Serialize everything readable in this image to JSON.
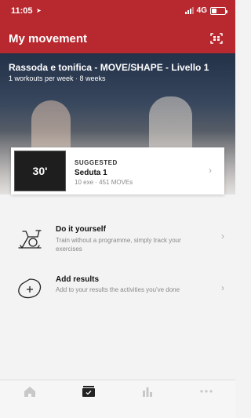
{
  "status_bar": {
    "time": "11:05",
    "network": "4G"
  },
  "header": {
    "title": "My movement"
  },
  "program": {
    "title": "Rassoda e tonifica - MOVE/SHAPE - Livello 1",
    "subtitle": "1 workouts per week · 8 weeks"
  },
  "suggested_card": {
    "thumb_label": "30'",
    "tag": "SUGGESTED",
    "name": "Seduta 1",
    "meta": "10 exe · 451 MOVEs"
  },
  "options": [
    {
      "title": "Do it yourself",
      "description": "Train without a programme, simply track your exercises",
      "icon": "exercise-bike-icon"
    },
    {
      "title": "Add results",
      "description": "Add to your results the activities you've done",
      "icon": "add-results-icon"
    }
  ],
  "tabs": [
    {
      "icon": "home-icon",
      "active": false
    },
    {
      "icon": "program-icon",
      "active": true
    },
    {
      "icon": "stats-icon",
      "active": false
    },
    {
      "icon": "more-icon",
      "active": false
    }
  ],
  "colors": {
    "brand": "#b8282f",
    "background": "#f3f3f3"
  }
}
